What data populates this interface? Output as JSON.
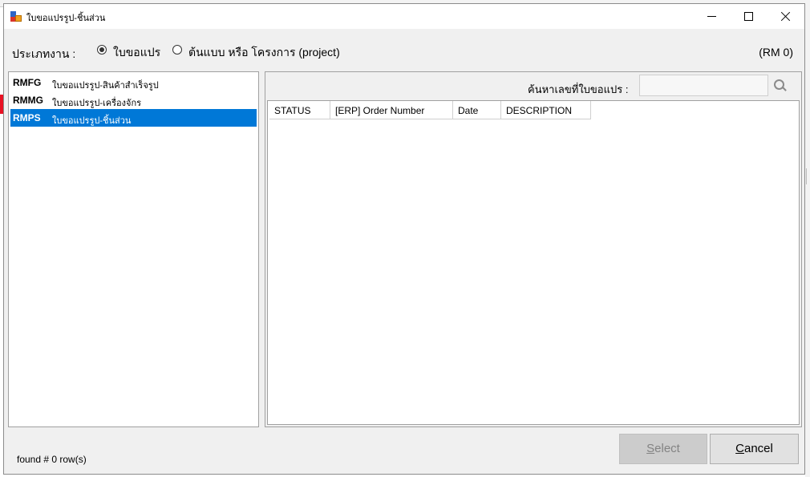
{
  "window": {
    "title": "ใบขอแปรรูป-ชิ้นส่วน",
    "buttons": {
      "minimize_icon": "minimize-icon",
      "maximize_icon": "maximize-icon",
      "close_icon": "close-icon"
    }
  },
  "type_selector": {
    "label": "ประเภทงาน :",
    "options": [
      {
        "label": "ใบขอแปร",
        "checked": true
      },
      {
        "label": "ต้นแบบ หรือ โครงการ (project)",
        "checked": false
      }
    ]
  },
  "rm_count": "(RM 0)",
  "request_types": [
    {
      "code": "RMFG",
      "description": "ใบขอแปรรูป-สินค้าสำเร็จรูป",
      "selected": false
    },
    {
      "code": "RMMG",
      "description": "ใบขอแปรรูป-เครื่องจักร",
      "selected": false
    },
    {
      "code": "RMPS",
      "description": "ใบขอแปรรูป-ชิ้นส่วน",
      "selected": true
    }
  ],
  "search": {
    "label": "ค้นหาเลขที่ใบขอแปร :",
    "value": "",
    "icon": "search-icon"
  },
  "grid": {
    "columns": [
      "STATUS",
      "[ERP] Order Number",
      "Date",
      "DESCRIPTION"
    ],
    "rows": []
  },
  "status_text": "found # 0 row(s)",
  "buttons": {
    "select": {
      "underline": "S",
      "rest": "elect",
      "enabled": false
    },
    "cancel": {
      "underline": "C",
      "rest": "ancel",
      "enabled": true
    }
  },
  "colors": {
    "selection": "#0078d7",
    "dialog_bg": "#f0f0f0"
  }
}
